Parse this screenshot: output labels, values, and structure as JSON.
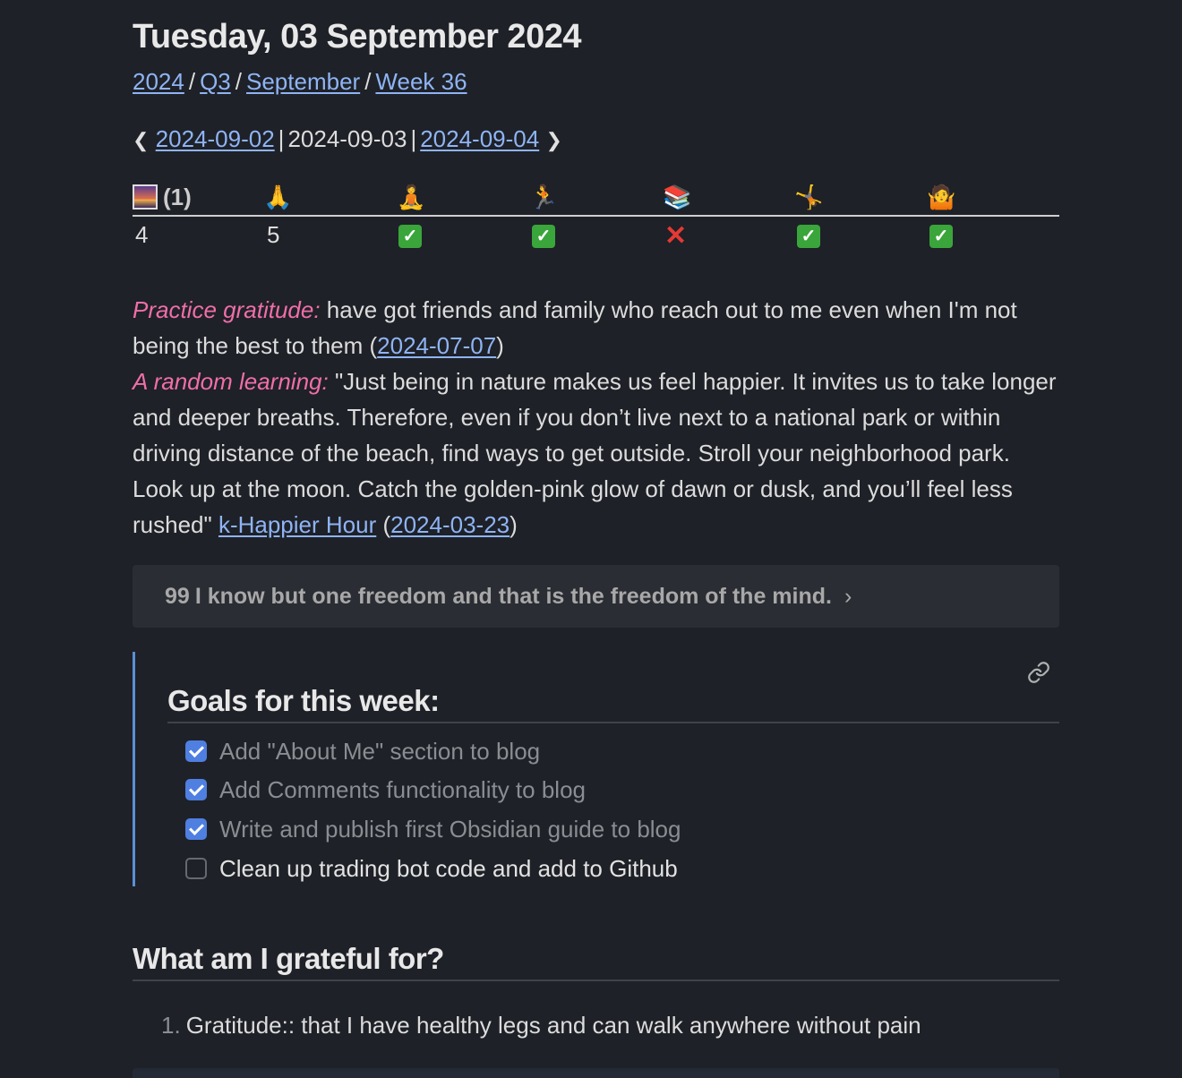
{
  "note": {
    "title": "Tuesday, 03 September 2024",
    "breadcrumb": [
      {
        "label": "2024"
      },
      {
        "label": "Q3"
      },
      {
        "label": "September"
      },
      {
        "label": "Week 36"
      }
    ],
    "breadcrumb_sep": "/",
    "daynav": {
      "prev_arrow": "❮",
      "prev": "2024-09-02",
      "current": "2024-09-03",
      "next": "2024-09-04",
      "next_arrow": "❯",
      "pipe": "|"
    }
  },
  "habits": {
    "headers": [
      {
        "icon": "sunrise-icon",
        "glyph": "",
        "count": "(1)"
      },
      {
        "icon": "folded-hands-icon",
        "glyph": "🙏"
      },
      {
        "icon": "meditation-icon",
        "glyph": "🧘"
      },
      {
        "icon": "running-icon",
        "glyph": "🏃"
      },
      {
        "icon": "books-icon",
        "glyph": "📚"
      },
      {
        "icon": "cartwheel-icon",
        "glyph": "🤸"
      },
      {
        "icon": "shrug-icon",
        "glyph": "🤷"
      }
    ],
    "values": [
      "4",
      "5",
      "✅",
      "✅",
      "❌",
      "✅",
      "✅"
    ]
  },
  "prompts": {
    "gratitude_label": "Practice gratitude:",
    "gratitude_text": " have got friends and family who reach out to me even when I'm not being the best to them (",
    "gratitude_link": "2024-07-07",
    "gratitude_close": ")",
    "learning_label": "A random learning:",
    "learning_text": " \"Just being in nature makes us feel happier. It invites us to take longer and deeper breaths. Therefore, even if you don’t live next to a national park or within driving distance of the beach, find ways to get outside. Stroll your neighborhood park. Look up at the moon. Catch the golden-pink glow of dawn or dusk, and you’ll feel less rushed\" ",
    "learning_link1": "k-Happier Hour",
    "learning_mid": " (",
    "learning_link2": "2024-03-23",
    "learning_close": ")"
  },
  "quote": {
    "icon": "quote-icon",
    "glyph": "99",
    "text": "I know but one freedom and that is the freedom of the mind.",
    "chevron": "›"
  },
  "goals": {
    "heading": "Goals for this week:",
    "link_icon": "link-icon",
    "tasks": [
      {
        "label": "Add \"About Me\" section to blog",
        "done": true
      },
      {
        "label": "Add Comments functionality to blog",
        "done": true
      },
      {
        "label": "Write and publish first Obsidian guide to blog",
        "done": true
      },
      {
        "label": "Clean up trading bot code and add to Github",
        "done": false
      }
    ]
  },
  "grateful": {
    "heading": "What am I grateful for?",
    "items": [
      {
        "num": "1.",
        "text": "Gratitude:: that I have healthy legs and can walk anywhere without pain"
      }
    ]
  },
  "colors": {
    "background": "#1e2127",
    "link": "#8fb4f5",
    "accent_pink": "#f06ea9",
    "checkbox_blue": "#4f7fe0",
    "callout_border": "#5a8fd6"
  }
}
